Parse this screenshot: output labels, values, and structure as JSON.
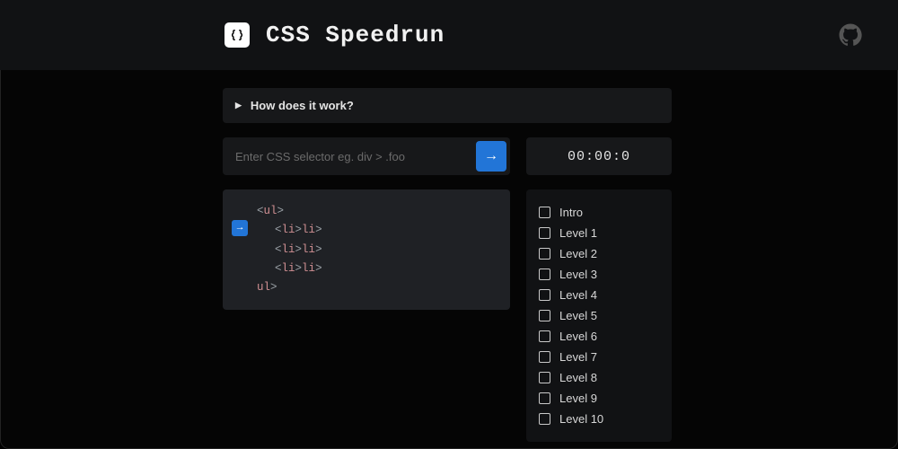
{
  "header": {
    "title": "CSS Speedrun"
  },
  "howto": {
    "label": "How does it work?"
  },
  "input": {
    "placeholder": "Enter CSS selector eg. div > .foo"
  },
  "timer": {
    "value": "00:00:0"
  },
  "code": {
    "lines": [
      {
        "indent": 0,
        "open": "<",
        "tag": "ul",
        "close": ">"
      },
      {
        "indent": 1,
        "open": "<",
        "tag": "li",
        "mid": "></",
        "tag2": "li",
        "close": ">"
      },
      {
        "indent": 1,
        "open": "<",
        "tag": "li",
        "mid": "></",
        "tag2": "li",
        "close": ">"
      },
      {
        "indent": 1,
        "open": "<",
        "tag": "li",
        "mid": "></",
        "tag2": "li",
        "close": ">"
      },
      {
        "indent": 0,
        "open": "</",
        "tag": "ul",
        "close": ">"
      }
    ]
  },
  "levels": {
    "items": [
      "Intro",
      "Level 1",
      "Level 2",
      "Level 3",
      "Level 4",
      "Level 5",
      "Level 6",
      "Level 7",
      "Level 8",
      "Level 9",
      "Level 10"
    ]
  }
}
